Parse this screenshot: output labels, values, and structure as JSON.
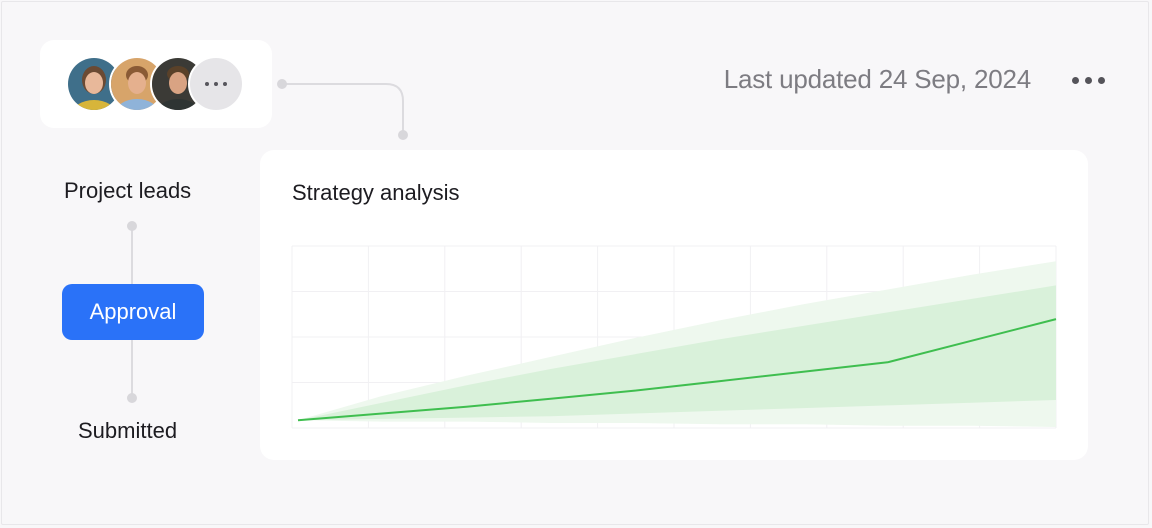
{
  "header": {
    "last_updated": "Last updated 24 Sep, 2024",
    "more_menu_icon": "more-horizontal-icon"
  },
  "team": {
    "avatars": [
      {
        "name": "avatar-woman",
        "bg": "#3f6f8a",
        "skin": "#e8b89a",
        "hair": "#6b4a33",
        "shirt": "#d7b53a"
      },
      {
        "name": "avatar-man-blue-shirt",
        "bg": "#d7a46a",
        "skin": "#e5b08e",
        "hair": "#8a5a35",
        "shirt": "#8fb3d9"
      },
      {
        "name": "avatar-man-dark",
        "bg": "#3b3a36",
        "skin": "#d9a383",
        "hair": "#5a4129",
        "shirt": "#2e3433"
      }
    ],
    "more_icon": "ellipsis-icon"
  },
  "workflow": {
    "steps": [
      "Project leads",
      "Approval",
      "Submitted"
    ],
    "active": "Approval"
  },
  "chart_data": {
    "type": "area",
    "title": "Strategy analysis",
    "x": [
      0,
      1,
      2,
      3,
      4,
      5,
      6,
      7,
      8,
      9
    ],
    "series": [
      {
        "values": [
          0.0,
          0.05,
          0.1,
          0.16,
          0.22,
          0.29,
          0.36,
          0.43,
          0.59,
          0.75
        ],
        "color": "#3fbe4f"
      }
    ],
    "bands": [
      {
        "upper": [
          0.0,
          0.18,
          0.33,
          0.47,
          0.61,
          0.74,
          0.86,
          0.97,
          1.08,
          1.18
        ],
        "lower": [
          0.0,
          -0.01,
          -0.01,
          -0.02,
          -0.02,
          -0.03,
          -0.03,
          -0.04,
          -0.04,
          -0.05
        ],
        "color": "#eef8ee"
      },
      {
        "upper": [
          0.0,
          0.13,
          0.26,
          0.38,
          0.49,
          0.6,
          0.7,
          0.8,
          0.9,
          1.0
        ],
        "lower": [
          0.0,
          0.01,
          0.02,
          0.03,
          0.05,
          0.07,
          0.09,
          0.11,
          0.13,
          0.15
        ],
        "color": "#d9f1da"
      }
    ],
    "ylim": [
      -0.05,
      1.3
    ],
    "grid": true,
    "gridlines": {
      "vertical": 10,
      "horizontal": 5
    },
    "accent": "#2a72f8"
  }
}
